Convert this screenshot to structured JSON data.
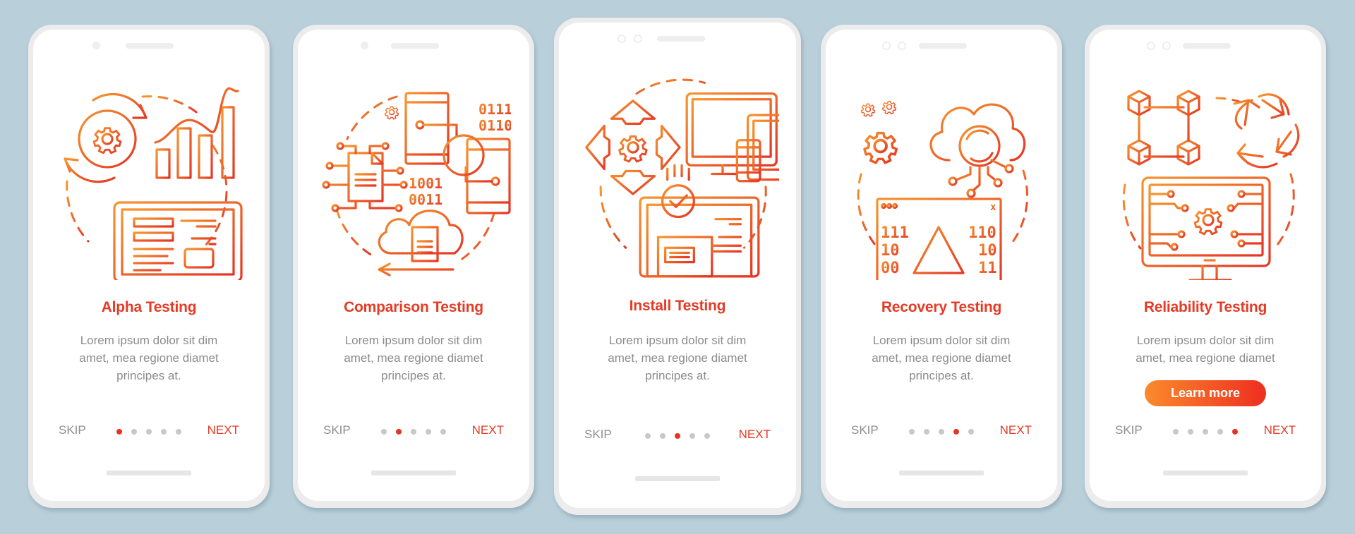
{
  "colors": {
    "background": "#b9cfda",
    "accent_red": "#e53a24",
    "gradient_start": "#fb8a2c",
    "gradient_end": "#ee2e20",
    "body_text": "#8c8c8c"
  },
  "screens": [
    {
      "illustration": "alpha-testing-illustration",
      "title": "Alpha Testing",
      "desc_lines": [
        "Lorem ipsum dolor sit dim",
        "amet, mea regione diamet",
        "principes at."
      ],
      "skip": "SKIP",
      "next": "NEXT",
      "page_index": 1,
      "page_count": 5
    },
    {
      "illustration": "comparison-testing-illustration",
      "title": "Comparison Testing",
      "desc_lines": [
        "Lorem ipsum dolor sit dim",
        "amet, mea regione diamet",
        "principes at."
      ],
      "skip": "SKIP",
      "next": "NEXT",
      "page_index": 2,
      "page_count": 5,
      "binary_top": [
        "0111",
        "0110"
      ],
      "binary_bottom": [
        "1001",
        "0011"
      ]
    },
    {
      "illustration": "install-testing-illustration",
      "title": "Install Testing",
      "desc_lines": [
        "Lorem ipsum dolor sit dim",
        "amet, mea regione diamet",
        "principes at."
      ],
      "skip": "SKIP",
      "next": "NEXT",
      "page_index": 3,
      "page_count": 5
    },
    {
      "illustration": "recovery-testing-illustration",
      "title": "Recovery Testing",
      "desc_lines": [
        "Lorem ipsum dolor sit dim",
        "amet, mea regione diamet",
        "principes at."
      ],
      "skip": "SKIP",
      "next": "NEXT",
      "page_index": 4,
      "page_count": 5,
      "binary_left": [
        "111",
        "10",
        "00"
      ],
      "binary_right": [
        "110",
        "10",
        "11"
      ],
      "window_close": "x"
    },
    {
      "illustration": "reliability-testing-illustration",
      "title": "Reliability Testing",
      "desc_lines": [
        "Lorem ipsum dolor sit dim",
        "amet, mea regione diamet"
      ],
      "cta": "Learn more",
      "skip": "SKIP",
      "next": "NEXT",
      "page_index": 5,
      "page_count": 5
    }
  ]
}
